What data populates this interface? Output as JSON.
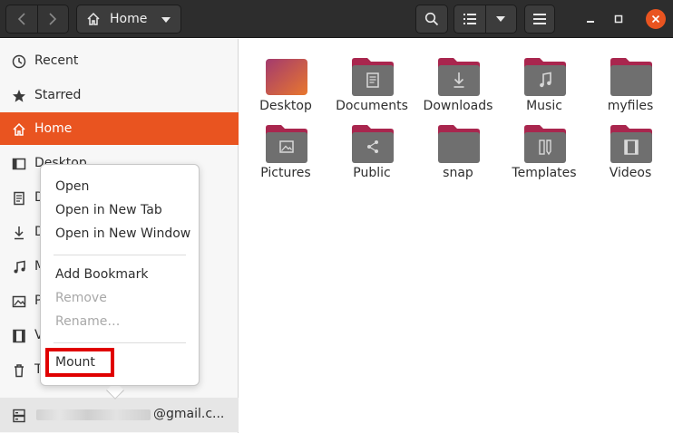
{
  "header": {
    "location": "Home",
    "icons": [
      "go-back-icon",
      "go-forward-icon",
      "home-icon",
      "dropdown-caret-icon",
      "search-icon",
      "list-view-icon",
      "view-options-caret-icon",
      "hamburger-menu-icon",
      "minimize-icon",
      "maximize-icon",
      "close-icon"
    ]
  },
  "sidebar": {
    "items": [
      {
        "label": "Recent",
        "icon": "clock-icon"
      },
      {
        "label": "Starred",
        "icon": "star-icon"
      },
      {
        "label": "Home",
        "icon": "home-icon",
        "active": true
      },
      {
        "label": "Desktop",
        "icon": "desktop-icon"
      },
      {
        "label": "D",
        "icon": "documents-icon"
      },
      {
        "label": "D",
        "icon": "downloads-icon"
      },
      {
        "label": "M",
        "icon": "music-icon"
      },
      {
        "label": "P",
        "icon": "pictures-icon"
      },
      {
        "label": "V",
        "icon": "videos-icon"
      },
      {
        "label": "T",
        "icon": "trash-icon"
      }
    ],
    "mount": {
      "email_suffix": "@gmail.c...",
      "icon": "network-drive-icon"
    }
  },
  "main": {
    "folders": [
      {
        "label": "Desktop",
        "icon": "desktop-folder-icon"
      },
      {
        "label": "Documents",
        "icon": "documents-folder-icon"
      },
      {
        "label": "Downloads",
        "icon": "downloads-folder-icon"
      },
      {
        "label": "Music",
        "icon": "music-folder-icon"
      },
      {
        "label": "myfiles",
        "icon": "folder-icon"
      },
      {
        "label": "Pictures",
        "icon": "pictures-folder-icon"
      },
      {
        "label": "Public",
        "icon": "public-folder-icon"
      },
      {
        "label": "snap",
        "icon": "folder-icon"
      },
      {
        "label": "Templates",
        "icon": "templates-folder-icon"
      },
      {
        "label": "Videos",
        "icon": "videos-folder-icon"
      }
    ]
  },
  "context_menu": {
    "items": [
      {
        "label": "Open",
        "enabled": true
      },
      {
        "label": "Open in New Tab",
        "enabled": true
      },
      {
        "label": "Open in New Window",
        "enabled": true
      },
      {
        "label": "Add Bookmark",
        "enabled": true
      },
      {
        "label": "Remove",
        "enabled": false
      },
      {
        "label": "Rename…",
        "enabled": false
      },
      {
        "label": "Mount",
        "enabled": true,
        "highlighted": true
      }
    ]
  },
  "colors": {
    "accent": "#e95420",
    "highlight": "#e00000",
    "folder_top": "#a9264e",
    "folder_body": "#6f6f6f"
  }
}
